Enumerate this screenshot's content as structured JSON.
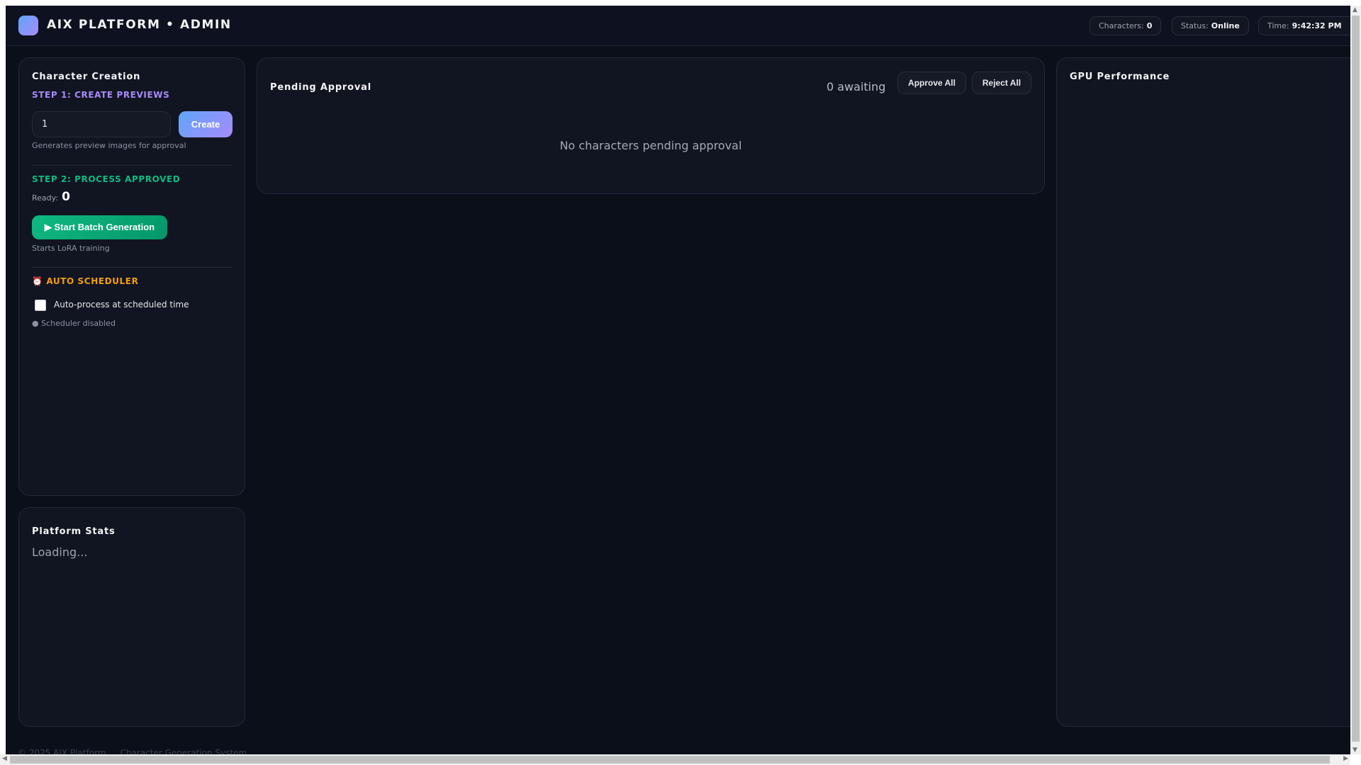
{
  "header": {
    "title": "AIX PLATFORM • ADMIN",
    "stats": [
      {
        "label": "Characters:",
        "value": "0"
      },
      {
        "label": "Status:",
        "value": "Online"
      },
      {
        "label": "Time:",
        "value": "9:42:32 PM"
      }
    ]
  },
  "creation": {
    "title": "Character Creation",
    "step1_label": "STEP 1: CREATE PREVIEWS",
    "count_value": "1",
    "create_label": "Create",
    "step1_help": "Generates preview images for approval",
    "step2_label": "STEP 2: PROCESS APPROVED",
    "ready_label": "Ready:",
    "ready_value": "0",
    "batch_label": "▶ Start Batch Generation",
    "step2_help": "Starts LoRA training",
    "scheduler_icon": "⏰",
    "scheduler_label": "AUTO SCHEDULER",
    "scheduler_checkbox_label": "Auto-process at scheduled time",
    "scheduler_checked": false,
    "scheduler_status": "● Scheduler disabled"
  },
  "stats": {
    "title": "Platform Stats",
    "loading": "Loading..."
  },
  "pending": {
    "title": "Pending Approval",
    "awaiting": "0 awaiting",
    "approve_all": "Approve All",
    "reject_all": "Reject All",
    "empty": "No characters pending approval"
  },
  "gpu": {
    "title": "GPU Performance"
  },
  "footer": {
    "copyright": "© 2025 AIX Platform",
    "tagline": "Character Generation System"
  },
  "colors": {
    "step1": "#a78bfa",
    "step2": "#10b981",
    "scheduler": "#f59e0b"
  }
}
